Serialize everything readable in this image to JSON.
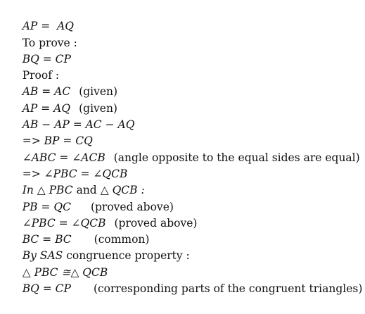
{
  "lines": [
    {
      "math": "AP =  AQ",
      "text": ""
    },
    {
      "math": "",
      "text": "To prove :"
    },
    {
      "math": "BQ = CP",
      "text": ""
    },
    {
      "math": "",
      "text": "Proof :"
    },
    {
      "math": "AB = AC",
      "text": "(given)"
    },
    {
      "math": "AP = AQ",
      "text": "(given)"
    },
    {
      "math": "AB − AP = AC − AQ",
      "text": ""
    },
    {
      "math": "=> BP = CQ",
      "text": ""
    },
    {
      "math": "∠ABC = ∠ACB",
      "text": "(angle opposite to the equal sides are equal)"
    },
    {
      "math": "=> ∠PBC = ∠QCB",
      "text": ""
    },
    {
      "math": "In △ PBC",
      "text": "and",
      "math2": "△ QCB :"
    },
    {
      "math": "PB = QC",
      "text": "(proved above)"
    },
    {
      "math": "∠PBC = ∠QCB",
      "text": "(proved above)"
    },
    {
      "math": "BC = BC",
      "text": "(common)"
    },
    {
      "math": "By SAS",
      "text": "congruence property :"
    },
    {
      "math": "△ PBC ≅△ QCB",
      "text": ""
    },
    {
      "math": "BQ = CP",
      "text": "(corresponding parts of the congruent triangles)"
    }
  ]
}
